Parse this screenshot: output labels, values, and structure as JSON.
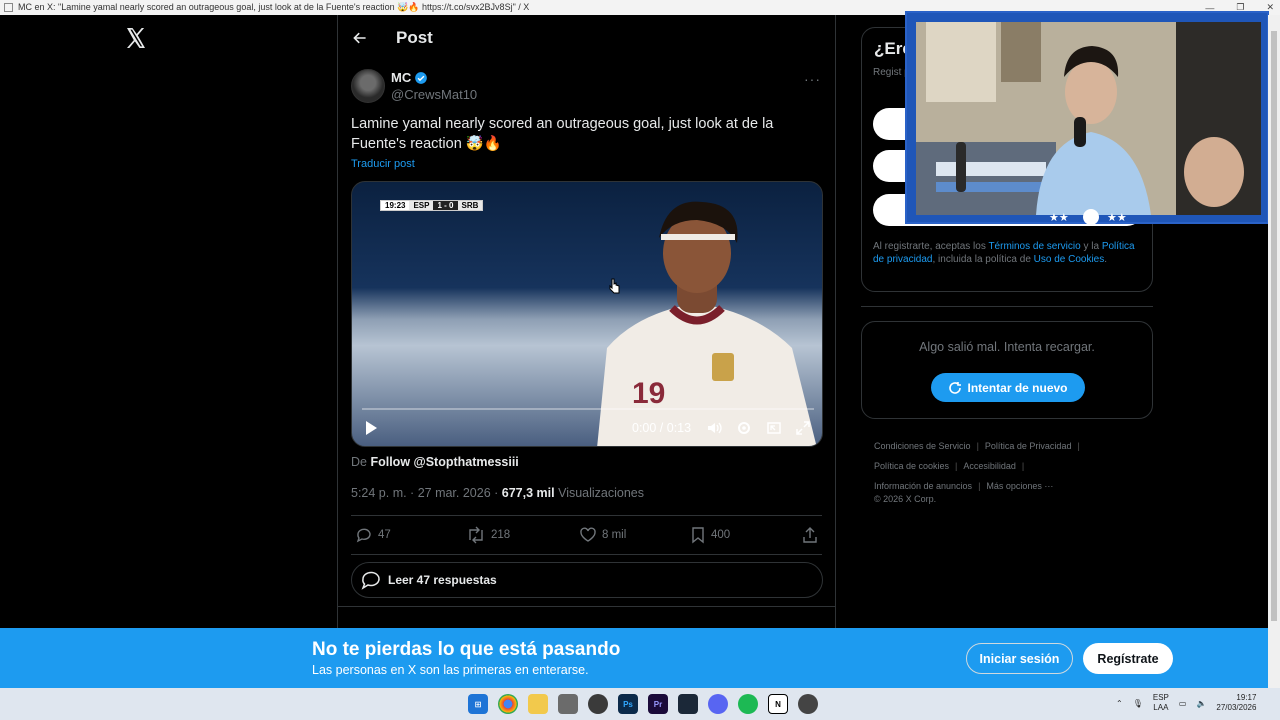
{
  "window": {
    "title": "MC en X: \"Lamine yamal nearly scored an outrageous goal, just look at de la Fuente's reaction 🤯🔥 https://t.co/svx2BJv8Sj\" / X"
  },
  "header": {
    "title": "Post"
  },
  "post": {
    "author_name": "MC",
    "author_handle": "@CrewsMat10",
    "text": "Lamine yamal nearly scored an outrageous goal, just look at de la Fuente's reaction 🤯🔥",
    "translate_label": "Traducir post",
    "media": {
      "scoreboard": {
        "time": "19:23",
        "home": "ESP",
        "score": "1 - 0",
        "away": "SRB"
      },
      "time_display": "0:00 / 0:13",
      "progress": 0
    },
    "source_prefix": "De",
    "source_name": "Follow @Stopthatmessiii",
    "timestamp": "5:24 p. m. · 27 mar. 2026 · ",
    "views_count": "677,3 mil",
    "views_label": " Visualizaciones",
    "actions": {
      "replies": "47",
      "reposts": "218",
      "likes": "8 mil",
      "bookmarks": "400"
    },
    "read_replies_label": "Leer 47 respuestas"
  },
  "sidebar": {
    "signup_title": "¿Ere",
    "signup_sub": "Regist perso",
    "terms": {
      "prefix": "Al registrarte, aceptas los ",
      "terms_link": "Términos de servicio",
      "mid": " y la ",
      "privacy_link": "Política de privacidad",
      "mid2": ", incluida la política de ",
      "cookies_link": "Uso de Cookies",
      "suffix": "."
    },
    "error_text": "Algo salió mal. Intenta recargar.",
    "retry_label": "Intentar de nuevo",
    "footer": {
      "links": [
        "Condiciones de Servicio",
        "Política de Privacidad",
        "Política de cookies",
        "Accesibilidad",
        "Información de anuncios",
        "Más opciones ···"
      ],
      "copyright": "© 2026 X Corp."
    }
  },
  "banner": {
    "title": "No te pierdas lo que está pasando",
    "subtitle": "Las personas en X son las primeras en enterarse.",
    "login_label": "Iniciar sesión",
    "register_label": "Regístrate"
  },
  "taskbar": {
    "lang_top": "ESP",
    "lang_bottom": "LAA",
    "time": "19:17",
    "date": "27/03/2026"
  },
  "colors": {
    "accent": "#1d9bf0",
    "background": "#000000",
    "border": "#2f3336",
    "muted_text": "#71767b"
  }
}
